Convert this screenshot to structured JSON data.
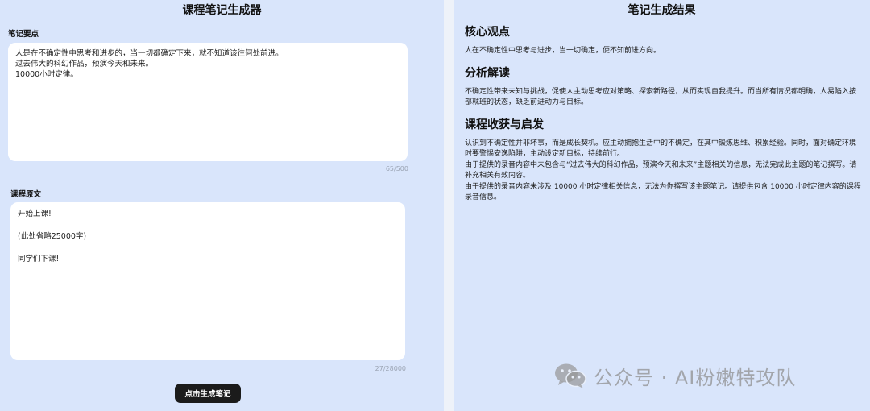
{
  "left": {
    "title": "课程笔记生成器",
    "notes_label": "笔记要点",
    "notes_value": "人是在不确定性中思考和进步的，当一切都确定下来，就不知道该往何处前进。\n过去伟大的科幻作品，预演今天和未来。\n10000小时定律。",
    "notes_counter": "65/500",
    "transcript_label": "课程原文",
    "transcript_value": "开始上课!\n\n(此处省略25000字)\n\n同学们下课!",
    "transcript_counter": "27/28000",
    "generate_button": "点击生成笔记"
  },
  "right": {
    "title": "笔记生成结果",
    "sections": [
      {
        "heading": "核心观点",
        "body": "人在不确定性中思考与进步，当一切确定，便不知前进方向。"
      },
      {
        "heading": "分析解读",
        "body": "不确定性带来未知与挑战，促使人主动思考应对策略、探索新路径，从而实现自我提升。而当所有情况都明确，人易陷入按部就班的状态，缺乏前进动力与目标。"
      },
      {
        "heading": "课程收获与启发",
        "body": "认识到不确定性并非坏事，而是成长契机。应主动拥抱生活中的不确定，在其中锻炼思维、积累经验。同时，面对确定环境时要警惕安逸陷阱，主动设定新目标，持续前行。\n由于提供的录音内容中未包含与“过去伟大的科幻作品，预演今天和未来”主题相关的信息，无法完成此主题的笔记撰写。请补充相关有效内容。\n由于提供的录音内容未涉及 10000 小时定律相关信息，无法为你撰写该主题笔记。请提供包含 10000 小时定律内容的课程录音信息。"
      }
    ]
  },
  "watermark": {
    "icon": "wechat-icon",
    "text": "公众号 · AI粉嫩特攻队"
  }
}
